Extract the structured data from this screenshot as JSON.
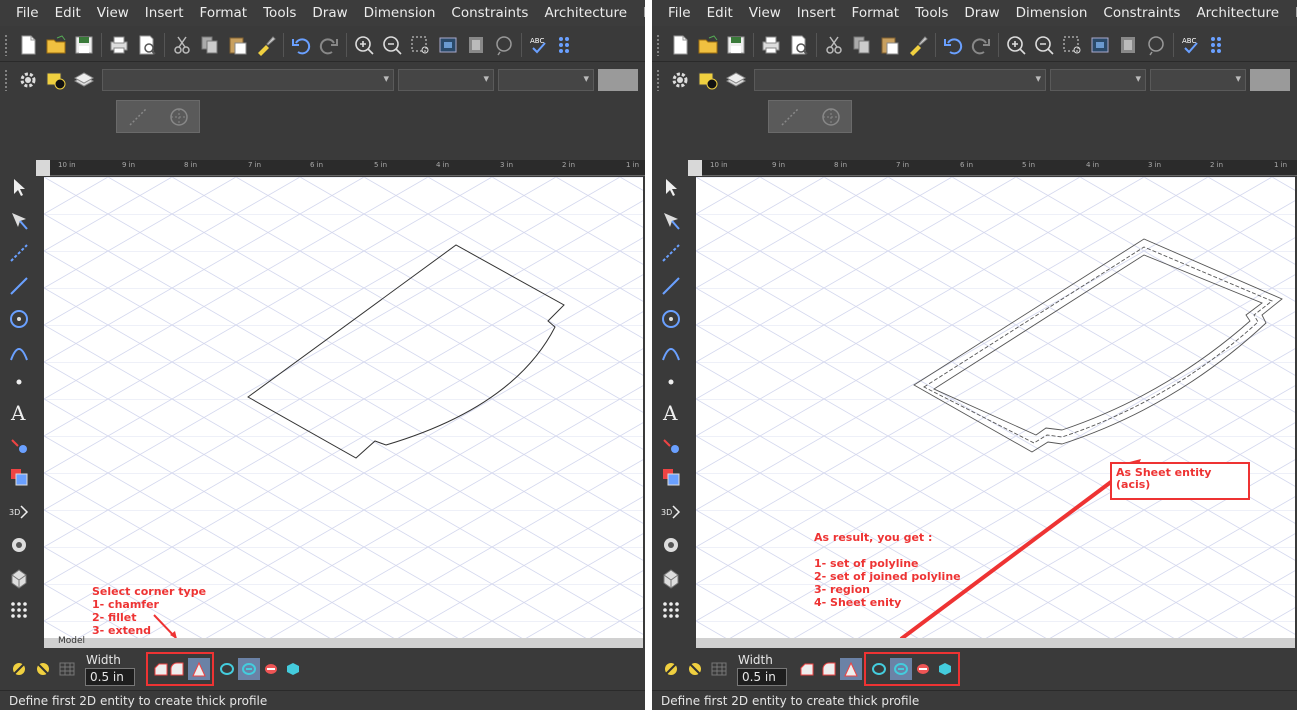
{
  "menus": [
    "File",
    "Edit",
    "View",
    "Insert",
    "Format",
    "Tools",
    "Draw",
    "Dimension",
    "Constraints",
    "Architecture",
    "Modify"
  ],
  "toolbar_icons": [
    "new-file-icon",
    "open-folder-icon",
    "save-icon",
    "print-icon",
    "print-preview-icon",
    "cut-icon",
    "copy-icon",
    "paste-icon",
    "match-properties-icon",
    "undo-icon",
    "redo-icon",
    "zoom-in-icon",
    "zoom-out-icon",
    "zoom-window-icon",
    "zoom-extents-icon",
    "zoom-previous-icon",
    "zoom-realtime-icon",
    "spell-check-icon",
    "grid-icon"
  ],
  "left_tools": [
    "select-arrow-icon",
    "pick-point-icon",
    "polyline-icon",
    "line-icon",
    "circle-icon",
    "arc-icon",
    "point-icon",
    "text-icon",
    "edit-icon",
    "layer-icon",
    "3d-icon",
    "render-icon",
    "box-icon",
    "grid-dots-icon"
  ],
  "ruler_ticks": [
    "10 in",
    "9 in",
    "8 in",
    "7 in",
    "6 in",
    "5 in",
    "4 in",
    "3 in",
    "2 in",
    "1 in"
  ],
  "panes": {
    "left": {
      "width_label": "Width",
      "width_value": "0.5 in",
      "status": "Define first 2D entity to create thick profile",
      "annotation": [
        "Select corner type",
        "1- chamfer",
        "2- fillet",
        "3- extend"
      ],
      "tab_label": "Model"
    },
    "right": {
      "width_label": "Width",
      "width_value": "0.5 in",
      "status": "Define first 2D entity to create thick profile",
      "annotation_result": [
        "As result, you get :",
        "",
        "1- set of polyline",
        "2- set of joined polyline",
        "3- region",
        "4- Sheet enity"
      ],
      "annotation_sheet": [
        "As Sheet entity",
        "(acis)"
      ]
    }
  },
  "colors": {
    "annotation_red": "#ee3333",
    "ui_dark": "#3a3a3a",
    "grid_line": "#c8cce8",
    "selected_btn": "#6b82a6"
  }
}
